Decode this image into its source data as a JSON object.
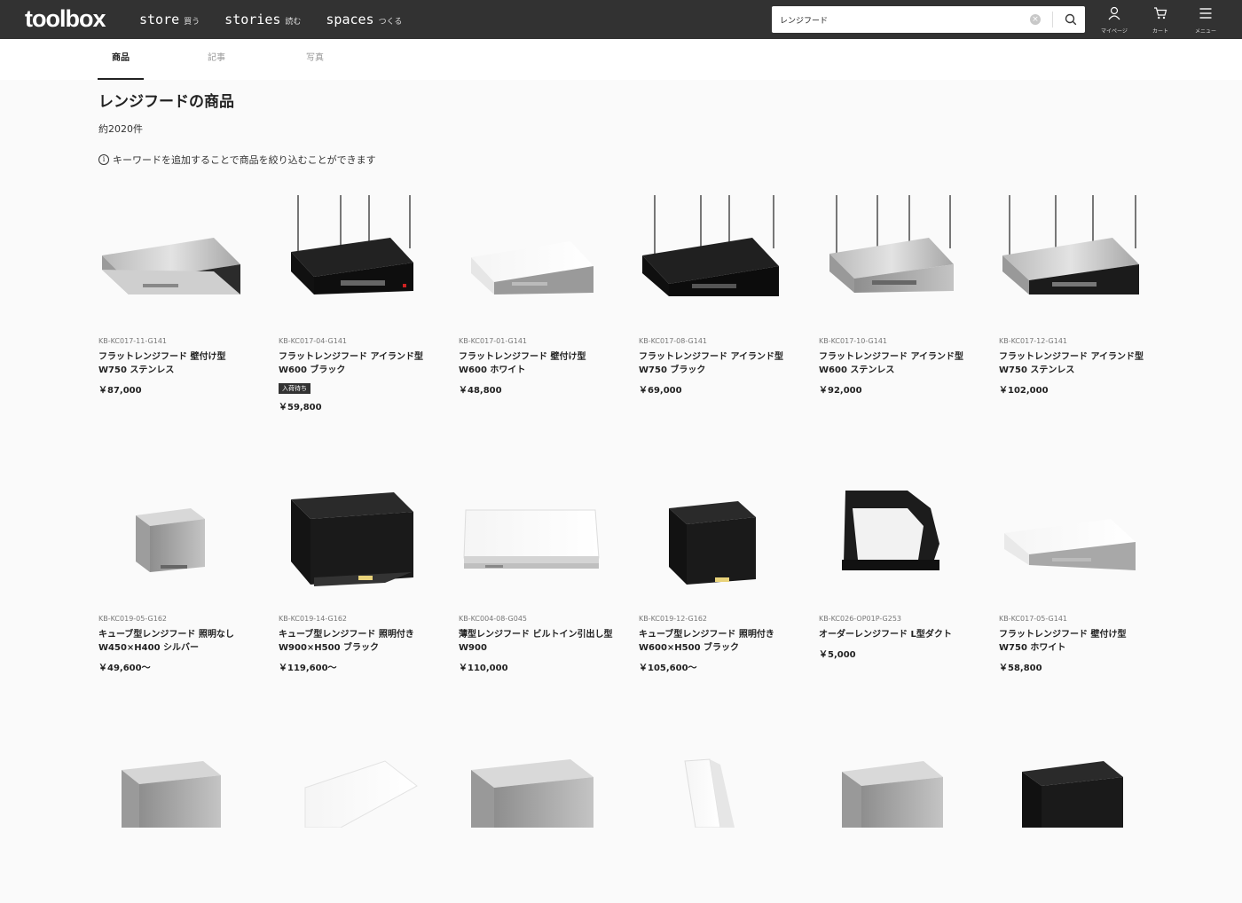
{
  "header": {
    "logo": "toolbox",
    "nav": [
      {
        "en": "store",
        "jp": "買う"
      },
      {
        "en": "stories",
        "jp": "読む"
      },
      {
        "en": "spaces",
        "jp": "つくる"
      }
    ],
    "search_value": "レンジフード",
    "icons": [
      {
        "icon": "user-icon",
        "label": "マイページ"
      },
      {
        "icon": "cart-icon",
        "label": "カート"
      },
      {
        "icon": "menu-icon",
        "label": "メニュー"
      }
    ]
  },
  "tabs": [
    "商品",
    "記事",
    "写真"
  ],
  "main": {
    "title": "レンジフードの商品",
    "count": "約2020件",
    "hint": "キーワードを追加することで商品を絞り込むことができます"
  },
  "products": [
    {
      "code": "KB-KC017-11-G141",
      "name": "フラットレンジフード 壁付け型 W750 ステンレス",
      "price": "￥87,000",
      "badge": ""
    },
    {
      "code": "KB-KC017-04-G141",
      "name": "フラットレンジフード アイランド型 W600 ブラック",
      "price": "￥59,800",
      "badge": "入荷待ち"
    },
    {
      "code": "KB-KC017-01-G141",
      "name": "フラットレンジフード 壁付け型 W600 ホワイト",
      "price": "￥48,800",
      "badge": ""
    },
    {
      "code": "KB-KC017-08-G141",
      "name": "フラットレンジフード アイランド型 W750 ブラック",
      "price": "￥69,000",
      "badge": ""
    },
    {
      "code": "KB-KC017-10-G141",
      "name": "フラットレンジフード アイランド型 W600 ステンレス",
      "price": "￥92,000",
      "badge": ""
    },
    {
      "code": "KB-KC017-12-G141",
      "name": "フラットレンジフード アイランド型 W750 ステンレス",
      "price": "￥102,000",
      "badge": ""
    },
    {
      "code": "KB-KC019-05-G162",
      "name": "キューブ型レンジフード 照明なし W450×H400 シルバー",
      "price": "￥49,600〜",
      "badge": ""
    },
    {
      "code": "KB-KC019-14-G162",
      "name": "キューブ型レンジフード 照明付き W900×H500 ブラック",
      "price": "￥119,600〜",
      "badge": ""
    },
    {
      "code": "KB-KC004-08-G045",
      "name": "薄型レンジフード ビルトイン引出し型 W900",
      "price": "￥110,000",
      "badge": ""
    },
    {
      "code": "KB-KC019-12-G162",
      "name": "キューブ型レンジフード 照明付き W600×H500 ブラック",
      "price": "￥105,600〜",
      "badge": ""
    },
    {
      "code": "KB-KC026-OP01P-G253",
      "name": "オーダーレンジフード L型ダクト",
      "price": "￥5,000",
      "badge": ""
    },
    {
      "code": "KB-KC017-05-G141",
      "name": "フラットレンジフード 壁付け型 W750 ホワイト",
      "price": "￥58,800",
      "badge": ""
    }
  ],
  "colors": {
    "header_bg": "#323232",
    "page_bg": "#fafafa",
    "stainless": "#c9c9c9",
    "black": "#151515"
  }
}
